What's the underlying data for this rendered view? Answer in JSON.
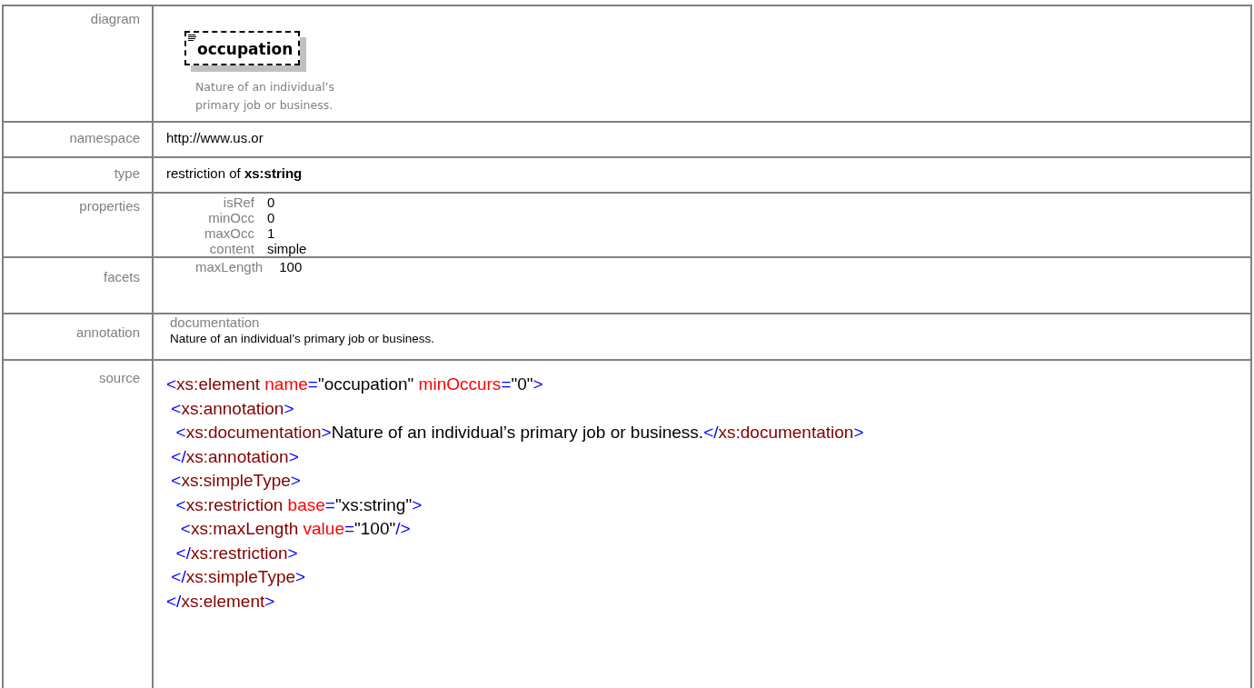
{
  "rows": [
    {
      "kind": "diagram",
      "label": "diagram",
      "element": "occupation",
      "description": "Nature of an individual’s primary job or business."
    },
    {
      "kind": "text",
      "label": "namespace",
      "value": "http://www.us.or"
    },
    {
      "kind": "text",
      "label": "type",
      "value": "restriction of **xs:string**"
    },
    {
      "kind": "props",
      "label": "properties",
      "items": [
        {
          "name": "isRef",
          "value": "0"
        },
        {
          "name": "minOcc",
          "value": "0"
        },
        {
          "name": "maxOcc",
          "value": "1"
        },
        {
          "name": "content",
          "value": "simple"
        }
      ]
    },
    {
      "kind": "props",
      "label": "facets",
      "items": [
        {
          "name": "maxLength",
          "value": "100"
        }
      ]
    },
    {
      "kind": "annotation",
      "label": "annotation",
      "heading": "documentation",
      "value": "Nature of an individual’s primary job or business."
    },
    {
      "kind": "source",
      "label": "source",
      "lines": [
        "<xs:element name=\"occupation\" minOccurs=\"0\">",
        " <xs:annotation>",
        "  <xs:documentation>Nature of an individual’s primary job or business.</xs:documentation>",
        " </xs:annotation>",
        " <xs:simpleType>",
        "  <xs:restriction base=\"xs:string\">",
        "   <xs:maxLength value=\"100\"/>",
        "  </xs:restriction>",
        " </xs:simpleType>",
        "</xs:element>"
      ]
    }
  ]
}
